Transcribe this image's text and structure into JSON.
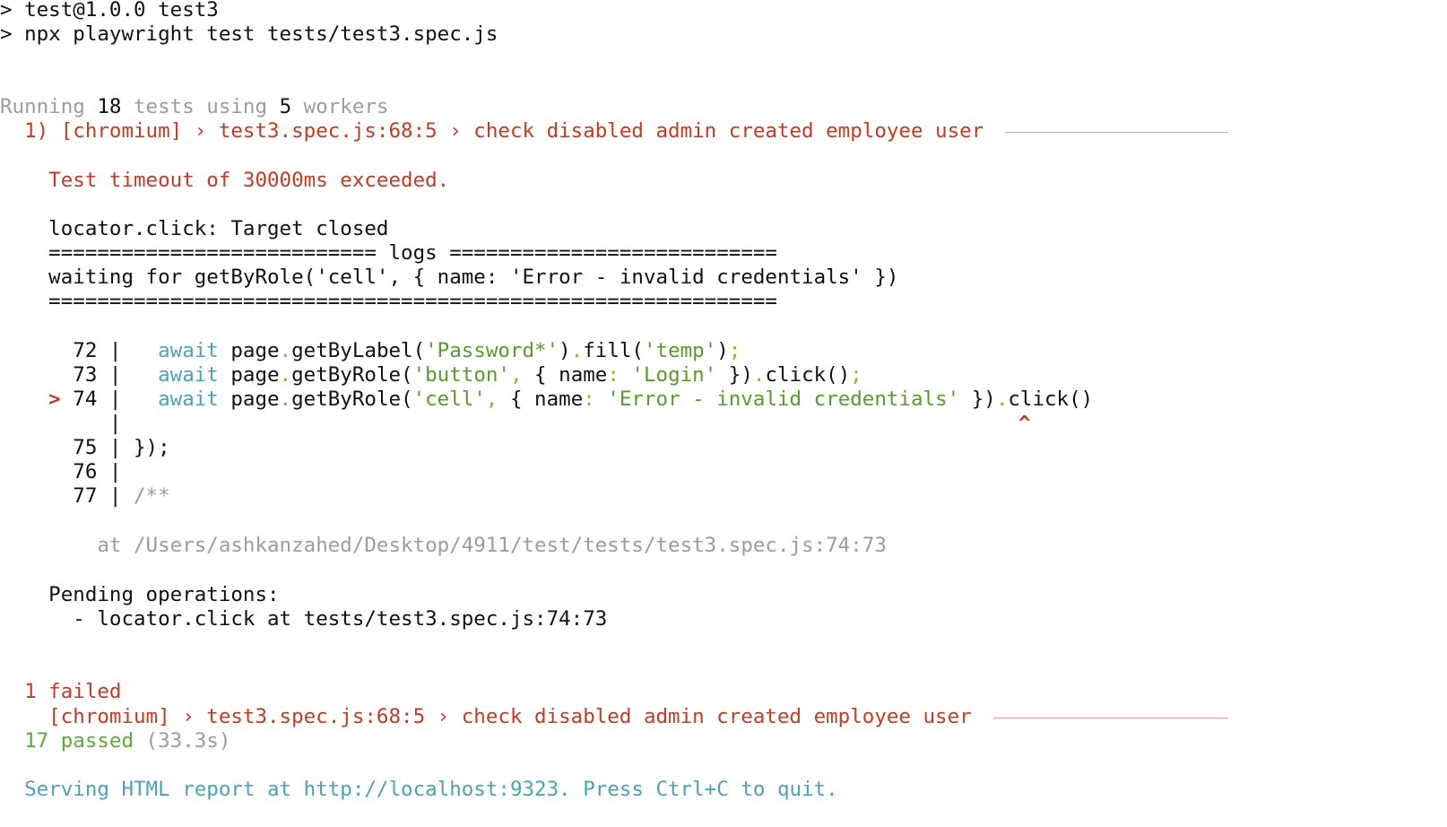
{
  "header": {
    "line1": "> test@1.0.0 test3",
    "line2": "> npx playwright test tests/test3.spec.js"
  },
  "running": {
    "prefix": "Running ",
    "tests_count": "18",
    "tests_word": " tests using ",
    "workers_count": "5",
    "workers_word": " workers"
  },
  "failure": {
    "heading": "  1) [chromium] › test3.spec.js:68:5 › check disabled admin created employee user ",
    "timeout": "    Test timeout of 30000ms exceeded.",
    "locator_error": "    locator.click: Target closed",
    "logs_header": "    =========================== logs ===========================",
    "waiting_line": "    waiting for getByRole('cell', { name: 'Error - invalid credentials' })",
    "logs_footer": "    ============================================================",
    "code": {
      "l72_num": "      72 | ",
      "l72_await": "  await",
      "l72_page": " page",
      "l72_dot1": ".",
      "l72_call1": "getByLabel(",
      "l72_str1": "'Password*'",
      "l72_close1": ")",
      "l72_dot2": ".",
      "l72_call2": "fill(",
      "l72_str2": "'temp'",
      "l72_close2": ")",
      "l72_semi": ";",
      "l73_num": "      73 | ",
      "l73_await": "  await",
      "l73_page": " page",
      "l73_dot1": ".",
      "l73_call1": "getByRole(",
      "l73_str1": "'button'",
      "l73_comma": ",",
      "l73_obj1": " { name",
      "l73_colon": ":",
      "l73_str2": " 'Login'",
      "l73_obj2": " })",
      "l73_dot2": ".",
      "l73_call2": "click()",
      "l73_semi": ";",
      "l74_marker": "    > ",
      "l74_num": "74 | ",
      "l74_await": "  await",
      "l74_page": " page",
      "l74_dot1": ".",
      "l74_call1": "getByRole(",
      "l74_str1": "'cell'",
      "l74_comma": ",",
      "l74_obj1": " { name",
      "l74_colon": ":",
      "l74_str2": " 'Error - invalid credentials'",
      "l74_obj2": " })",
      "l74_dot2": ".",
      "l74_call2": "click()",
      "pipe_line": "         | ",
      "caret": "^",
      "l75_num": "      75 | ",
      "l75_code": "});",
      "l76_num": "      76 | ",
      "l77_num": "      77 | ",
      "l77_code": "/**"
    },
    "at_line": "        at /Users/ashkanzahed/Desktop/4911/test/tests/test3.spec.js:74:73",
    "pending_title": "    Pending operations:",
    "pending_item": "      - locator.click at tests/test3.spec.js:74:73"
  },
  "summary": {
    "failed": "  1 failed",
    "failed_detail": "    [chromium] › test3.spec.js:68:5 › check disabled admin created employee user ",
    "passed": "  17 passed",
    "duration": " (33.3s)",
    "report": "  Serving HTML report at http://localhost:9323. Press Ctrl+C to quit."
  },
  "colors": {
    "error": "#c23b22",
    "pass": "#5fa83f",
    "info": "#4aa3b8",
    "dim": "#9c9c9c"
  }
}
